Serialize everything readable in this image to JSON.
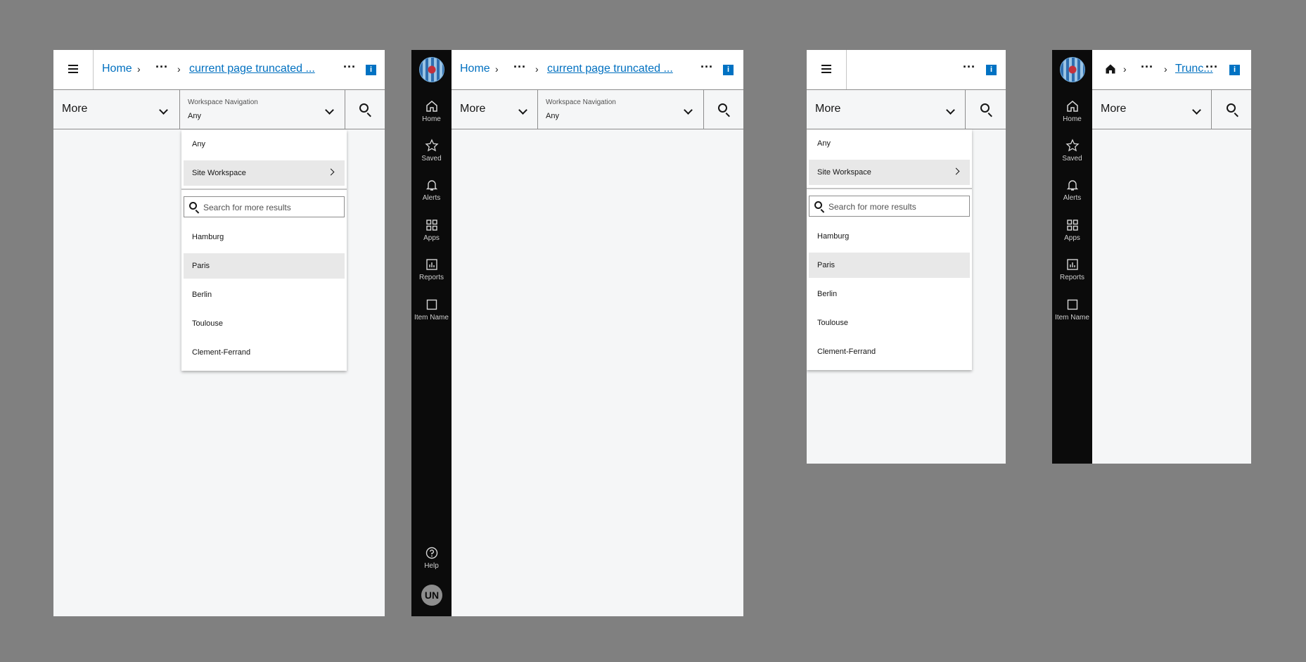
{
  "header": {
    "home_label": "Home",
    "chevron": "›",
    "overflow": "···",
    "current_page": "current page truncated ...",
    "current_page_short": "Trunc...",
    "info_label": "i"
  },
  "toolbar": {
    "more_label": "More",
    "workspace_caption": "Workspace Navigation",
    "workspace_value": "Any"
  },
  "dropdown": {
    "options": [
      "Any",
      "Site Workspace"
    ],
    "search_placeholder": "Search for more results",
    "results": [
      "Hamburg",
      "Paris",
      "Berlin",
      "Toulouse",
      "Clement-Ferrand"
    ]
  },
  "sidenav": {
    "items": [
      "Home",
      "Saved",
      "Alerts",
      "Apps",
      "Reports",
      "Item Name"
    ],
    "help_label": "Help",
    "avatar_initials": "UN"
  },
  "colors": {
    "link": "#0070c0",
    "info": "#0072c3",
    "sidenav_bg": "#0b0b0b",
    "highlight": "#e8e8e8"
  }
}
